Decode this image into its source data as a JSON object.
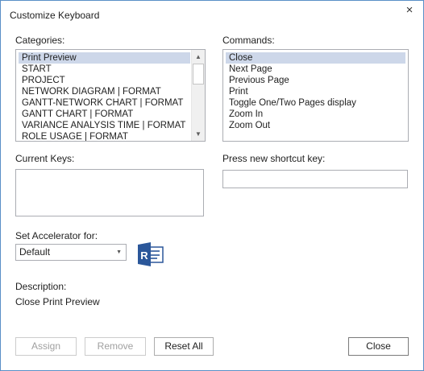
{
  "window": {
    "title": "Customize Keyboard",
    "close_glyph": "×"
  },
  "categories": {
    "label": "Categories:",
    "items": [
      "Print Preview",
      "START",
      "PROJECT",
      "NETWORK DIAGRAM | FORMAT",
      "GANTT-NETWORK CHART | FORMAT",
      "GANTT CHART | FORMAT",
      "VARIANCE ANALYSIS TIME | FORMAT",
      "ROLE USAGE | FORMAT"
    ],
    "selected_index": 0
  },
  "commands": {
    "label": "Commands:",
    "items": [
      "Close",
      "Next Page",
      "Previous Page",
      "Print",
      "Toggle One/Two Pages display",
      "Zoom In",
      "Zoom Out"
    ],
    "selected_index": 0
  },
  "current_keys": {
    "label": "Current Keys:"
  },
  "new_shortcut": {
    "label": "Press new shortcut key:",
    "value": ""
  },
  "accelerator": {
    "label": "Set Accelerator for:",
    "value": "Default",
    "icon": "project-app-icon"
  },
  "description": {
    "label": "Description:",
    "text": "Close Print Preview"
  },
  "buttons": {
    "assign": "Assign",
    "remove": "Remove",
    "reset_all": "Reset All",
    "close": "Close"
  },
  "colors": {
    "selection": "#cdd7e9",
    "window_border": "#5a8fc7",
    "icon_blue": "#2b579a"
  }
}
